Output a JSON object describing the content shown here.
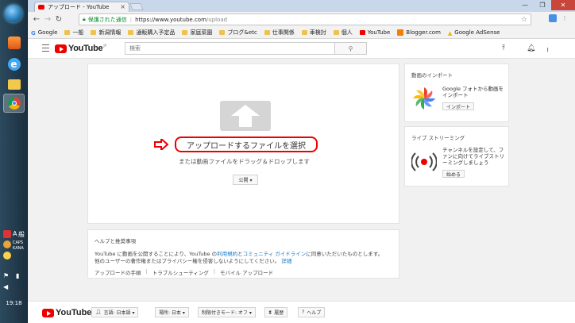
{
  "taskbar": {
    "ime_label": "A",
    "ime_mode": "般",
    "tray_caps": "CAPS",
    "tray_kana": "KANA",
    "clock": "19:18"
  },
  "browser": {
    "tab_title": "アップロード - YouTube",
    "tab_close": "×",
    "window_buttons": [
      "—",
      "❐",
      "✕"
    ],
    "secure_label": "保護された通信",
    "url_base": "https://www.youtube.com",
    "url_path": "/upload",
    "bookmarks": [
      "Google",
      "一般",
      "新潟情報",
      "通販購入予定品",
      "家庭菜園",
      "ブログ&etc",
      "仕事関係",
      "車検討",
      "個人",
      "YouTube",
      "Blogger.com",
      "Google AdSense"
    ]
  },
  "youtube": {
    "logo_text": "YouTube",
    "logo_region": "JP",
    "search_placeholder": "検索",
    "upload": {
      "select_label": "アップロードするファイルを選択",
      "drag_text": "または動画ファイルをドラッグ＆ドロップします",
      "privacy_label": "公開 ▾"
    },
    "help": {
      "title": "ヘルプと推奨事項",
      "text_before": "YouTube に動画を公開することにより、YouTube の",
      "link_terms": "利用規約",
      "text_and": "と",
      "link_guidelines": "コミュニティ ガイドライン",
      "text_after": "に同意いただいたものとします。",
      "line2": "他のユーザーの著作権またはプライバシー権を侵害しないようにしてください。",
      "link_detail": "詳細",
      "links": [
        "アップロードの手順",
        "トラブルシューティング",
        "モバイル アップロード"
      ]
    },
    "import_card": {
      "title": "動画のインポート",
      "desc": "Google フォトから動画をインポート",
      "button": "インポート"
    },
    "live_card": {
      "title": "ライブ ストリーミング",
      "desc": "チャンネルを設定して、ファンに向けてライブストリーミングしましょう",
      "button": "始める"
    },
    "footer": {
      "language": "言語: 日本語 ▾",
      "location": "場所: 日本 ▾",
      "restricted": "制限付きモード: オフ ▾",
      "history": "履歴",
      "help": "ヘルプ"
    }
  },
  "colors": {
    "youtube_red": "#e00000",
    "link_blue": "#167ac6",
    "secure_green": "#0a8a2a"
  }
}
